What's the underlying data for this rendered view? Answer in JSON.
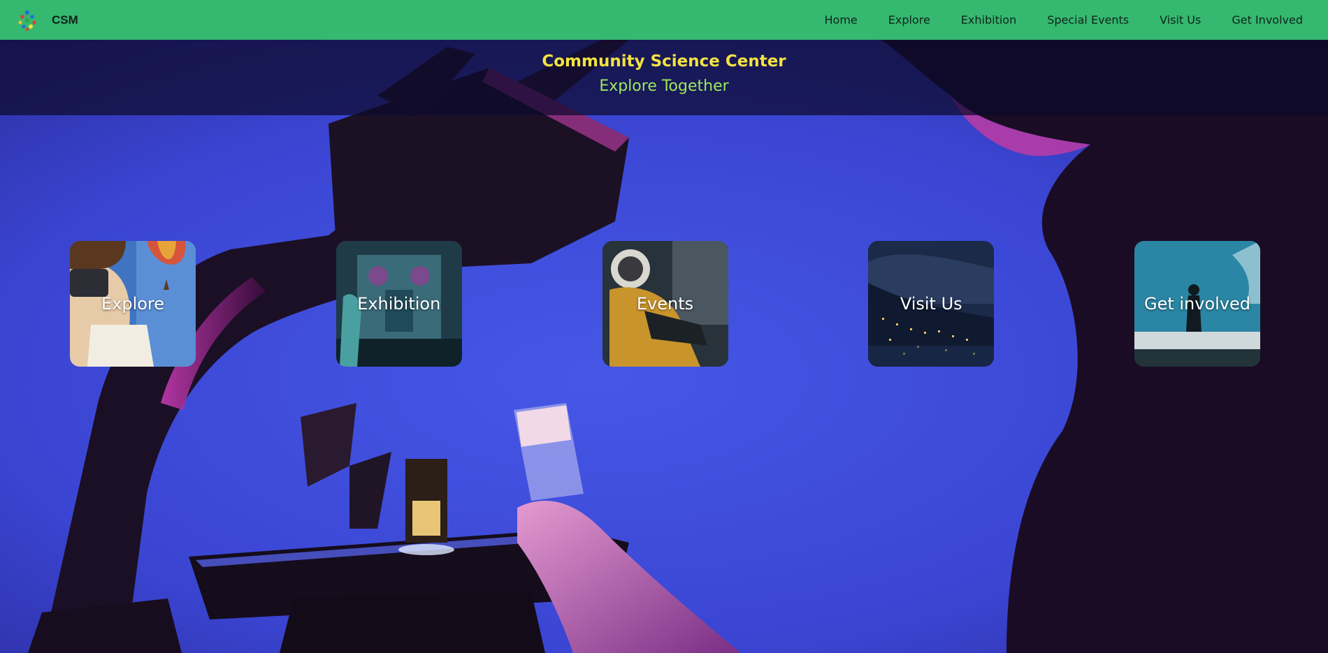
{
  "colors": {
    "nav_bg": "#35b870",
    "title_color": "#f2e341",
    "tagline_color": "#9ee85c",
    "hero_blue": "#3a4bd8",
    "card_text": "#ffffff"
  },
  "nav": {
    "brand": "CSM",
    "links": [
      {
        "label": "Home"
      },
      {
        "label": "Explore"
      },
      {
        "label": "Exhibition"
      },
      {
        "label": "Special Events"
      },
      {
        "label": "Visit Us"
      },
      {
        "label": "Get Involved"
      }
    ]
  },
  "hero": {
    "title": "Community Science Center",
    "tagline": "Explore Together"
  },
  "cards": [
    {
      "label": "Explore",
      "icon": "vr-kid-balloon-photo"
    },
    {
      "label": "Exhibition",
      "icon": "exhibit-machine-photo"
    },
    {
      "label": "Events",
      "icon": "astronaut-photo"
    },
    {
      "label": "Visit Us",
      "icon": "city-night-photo"
    },
    {
      "label": "Get involved",
      "icon": "aquarium-photo"
    }
  ]
}
